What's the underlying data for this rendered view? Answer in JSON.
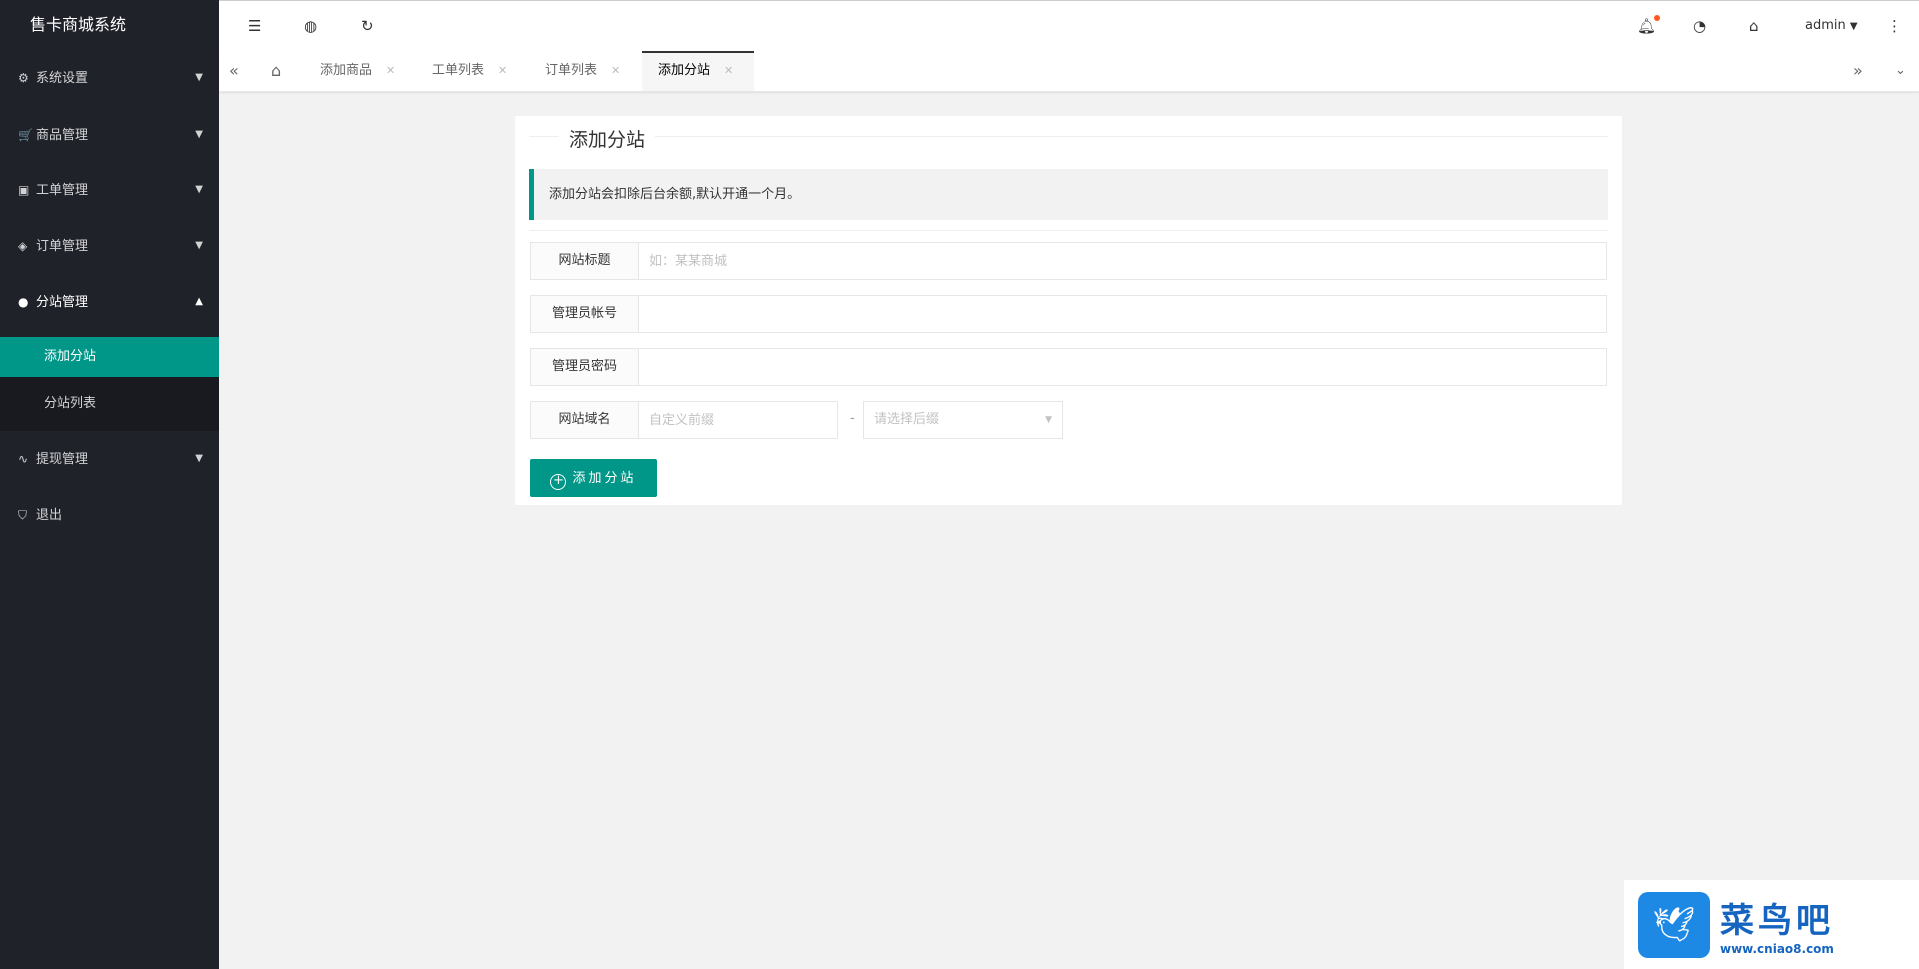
{
  "app_title": "售卡商城系统",
  "sidebar": {
    "items": [
      {
        "label": "系统设置",
        "icon": "gear-icon"
      },
      {
        "label": "商品管理",
        "icon": "cart-icon"
      },
      {
        "label": "工单管理",
        "icon": "ticket-icon"
      },
      {
        "label": "订单管理",
        "icon": "box-icon"
      },
      {
        "label": "分站管理",
        "icon": "globe-icon"
      },
      {
        "label": "提现管理",
        "icon": "pulse-icon"
      },
      {
        "label": "退出",
        "icon": "shield-icon"
      }
    ],
    "sub_items": [
      {
        "label": "添加分站",
        "active": true
      },
      {
        "label": "分站列表"
      }
    ]
  },
  "topbar": {
    "user": "admin"
  },
  "tabs": [
    {
      "label": "添加商品"
    },
    {
      "label": "工单列表"
    },
    {
      "label": "订单列表"
    },
    {
      "label": "添加分站",
      "active": true
    }
  ],
  "form": {
    "title": "添加分站",
    "notice": "添加分站会扣除后台余额,默认开通一个月。",
    "fields": [
      {
        "label": "网站标题",
        "placeholder": "如：某某商城"
      },
      {
        "label": "管理员帐号",
        "placeholder": ""
      },
      {
        "label": "管理员密码",
        "placeholder": ""
      },
      {
        "label": "网站域名",
        "prefix_placeholder": "自定义前缀",
        "separator": "-",
        "suffix_placeholder": "请选择后缀"
      }
    ],
    "submit": "添加分站"
  },
  "watermark": {
    "name": "菜鸟吧",
    "url": "www.cniao8.com"
  },
  "colors": {
    "accent": "#009688",
    "sidebar": "#20222a"
  }
}
